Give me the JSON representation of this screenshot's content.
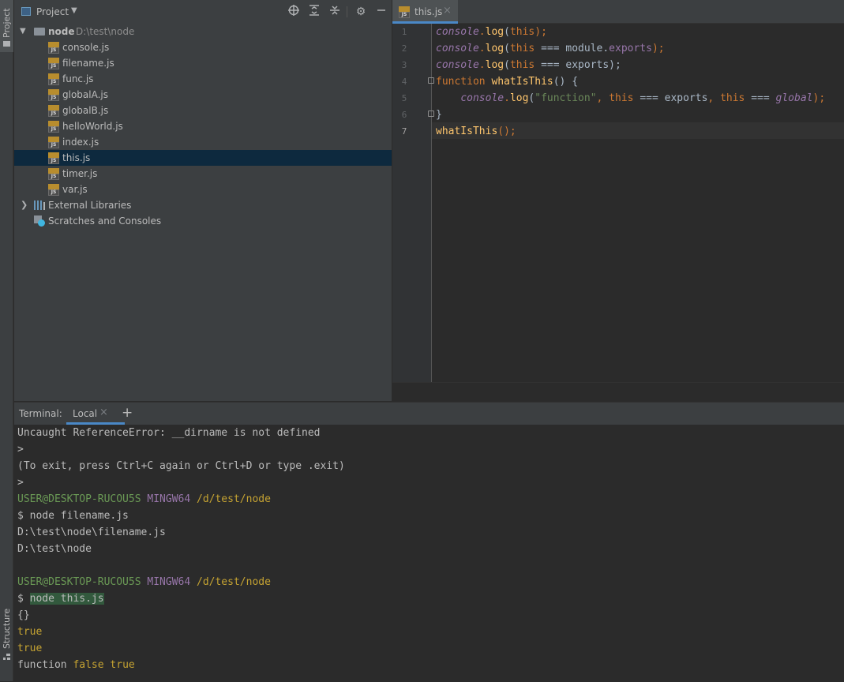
{
  "sidebar": {
    "project_tab": "Project",
    "structure_tab": "Structure"
  },
  "project_panel": {
    "title": "Project",
    "root": {
      "name": "node",
      "path": "D:\\test\\node"
    },
    "files": [
      "console.js",
      "filename.js",
      "func.js",
      "globalA.js",
      "globalB.js",
      "helloWorld.js",
      "index.js",
      "this.js",
      "timer.js",
      "var.js"
    ],
    "selected_file": "this.js",
    "external_libraries": "External Libraries",
    "scratches": "Scratches and Consoles",
    "file_icon_tag": "JS"
  },
  "editor": {
    "tab_label": "this.js",
    "tab_close": "×",
    "line_numbers": [
      "1",
      "2",
      "3",
      "4",
      "5",
      "6",
      "7"
    ],
    "lines": [
      [
        {
          "t": "console",
          "c": "#9876aa",
          "i": true
        },
        {
          "t": ".",
          "c": "#cc7832"
        },
        {
          "t": "log",
          "c": "#ffc66d"
        },
        {
          "t": "(",
          "c": "#a9b7c6"
        },
        {
          "t": "this",
          "c": "#cc7832"
        },
        {
          "t": ");",
          "c": "#cc7832"
        }
      ],
      [
        {
          "t": "console",
          "c": "#9876aa",
          "i": true
        },
        {
          "t": ".",
          "c": "#cc7832"
        },
        {
          "t": "log",
          "c": "#ffc66d"
        },
        {
          "t": "(",
          "c": "#a9b7c6"
        },
        {
          "t": "this",
          "c": "#cc7832"
        },
        {
          "t": " === module.",
          "c": "#a9b7c6"
        },
        {
          "t": "exports",
          "c": "#9876aa"
        },
        {
          "t": ");",
          "c": "#cc7832"
        }
      ],
      [
        {
          "t": "console",
          "c": "#9876aa",
          "i": true
        },
        {
          "t": ".",
          "c": "#cc7832"
        },
        {
          "t": "log",
          "c": "#ffc66d"
        },
        {
          "t": "(",
          "c": "#a9b7c6"
        },
        {
          "t": "this",
          "c": "#cc7832"
        },
        {
          "t": " === exports);",
          "c": "#a9b7c6"
        }
      ],
      [
        {
          "t": "function ",
          "c": "#cc7832"
        },
        {
          "t": "whatIsThis",
          "c": "#ffc66d"
        },
        {
          "t": "() {",
          "c": "#a9b7c6"
        }
      ],
      [
        {
          "t": "    ",
          "c": "#a9b7c6"
        },
        {
          "t": "console",
          "c": "#9876aa",
          "i": true
        },
        {
          "t": ".",
          "c": "#cc7832"
        },
        {
          "t": "log",
          "c": "#ffc66d"
        },
        {
          "t": "(",
          "c": "#a9b7c6"
        },
        {
          "t": "\"function\"",
          "c": "#6a8759"
        },
        {
          "t": ", ",
          "c": "#cc7832"
        },
        {
          "t": "this",
          "c": "#cc7832"
        },
        {
          "t": " === exports",
          "c": "#a9b7c6"
        },
        {
          "t": ", ",
          "c": "#cc7832"
        },
        {
          "t": "this",
          "c": "#cc7832"
        },
        {
          "t": " === ",
          "c": "#a9b7c6"
        },
        {
          "t": "global",
          "c": "#9876aa",
          "i": true
        },
        {
          "t": ");",
          "c": "#cc7832"
        }
      ],
      [
        {
          "t": "}",
          "c": "#a9b7c6"
        }
      ],
      [
        {
          "t": "whatIsThis",
          "c": "#ffc66d"
        },
        {
          "t": "();",
          "c": "#cc7832"
        }
      ]
    ]
  },
  "terminal": {
    "label": "Terminal:",
    "tab": "Local",
    "tab_close": "×",
    "add": "+",
    "lines": [
      [
        {
          "t": "Uncaught ReferenceError: __dirname is not defined"
        }
      ],
      [
        {
          "t": ">"
        }
      ],
      [
        {
          "t": "(To exit, press Ctrl+C again or Ctrl+D or type .exit)"
        }
      ],
      [
        {
          "t": ">"
        }
      ],
      [
        {
          "t": "USER@DESKTOP-RUCOU5S",
          "k": "g"
        },
        {
          "t": " "
        },
        {
          "t": "MINGW64",
          "k": "p"
        },
        {
          "t": " "
        },
        {
          "t": "/d/test/node",
          "k": "y"
        }
      ],
      [
        {
          "t": "$ node filename.js"
        }
      ],
      [
        {
          "t": "D:\\test\\node\\filename.js"
        }
      ],
      [
        {
          "t": "D:\\test\\node"
        }
      ],
      [
        {
          "t": ""
        }
      ],
      [
        {
          "t": "USER@DESKTOP-RUCOU5S",
          "k": "g"
        },
        {
          "t": " "
        },
        {
          "t": "MINGW64",
          "k": "p"
        },
        {
          "t": " "
        },
        {
          "t": "/d/test/node",
          "k": "y"
        }
      ],
      [
        {
          "t": "$ "
        },
        {
          "t": "node this.js",
          "k": "hl"
        }
      ],
      [
        {
          "t": "{}"
        }
      ],
      [
        {
          "t": "true",
          "k": "y"
        }
      ],
      [
        {
          "t": "true",
          "k": "y"
        }
      ],
      [
        {
          "t": "function "
        },
        {
          "t": "false true",
          "k": "y"
        }
      ]
    ]
  }
}
